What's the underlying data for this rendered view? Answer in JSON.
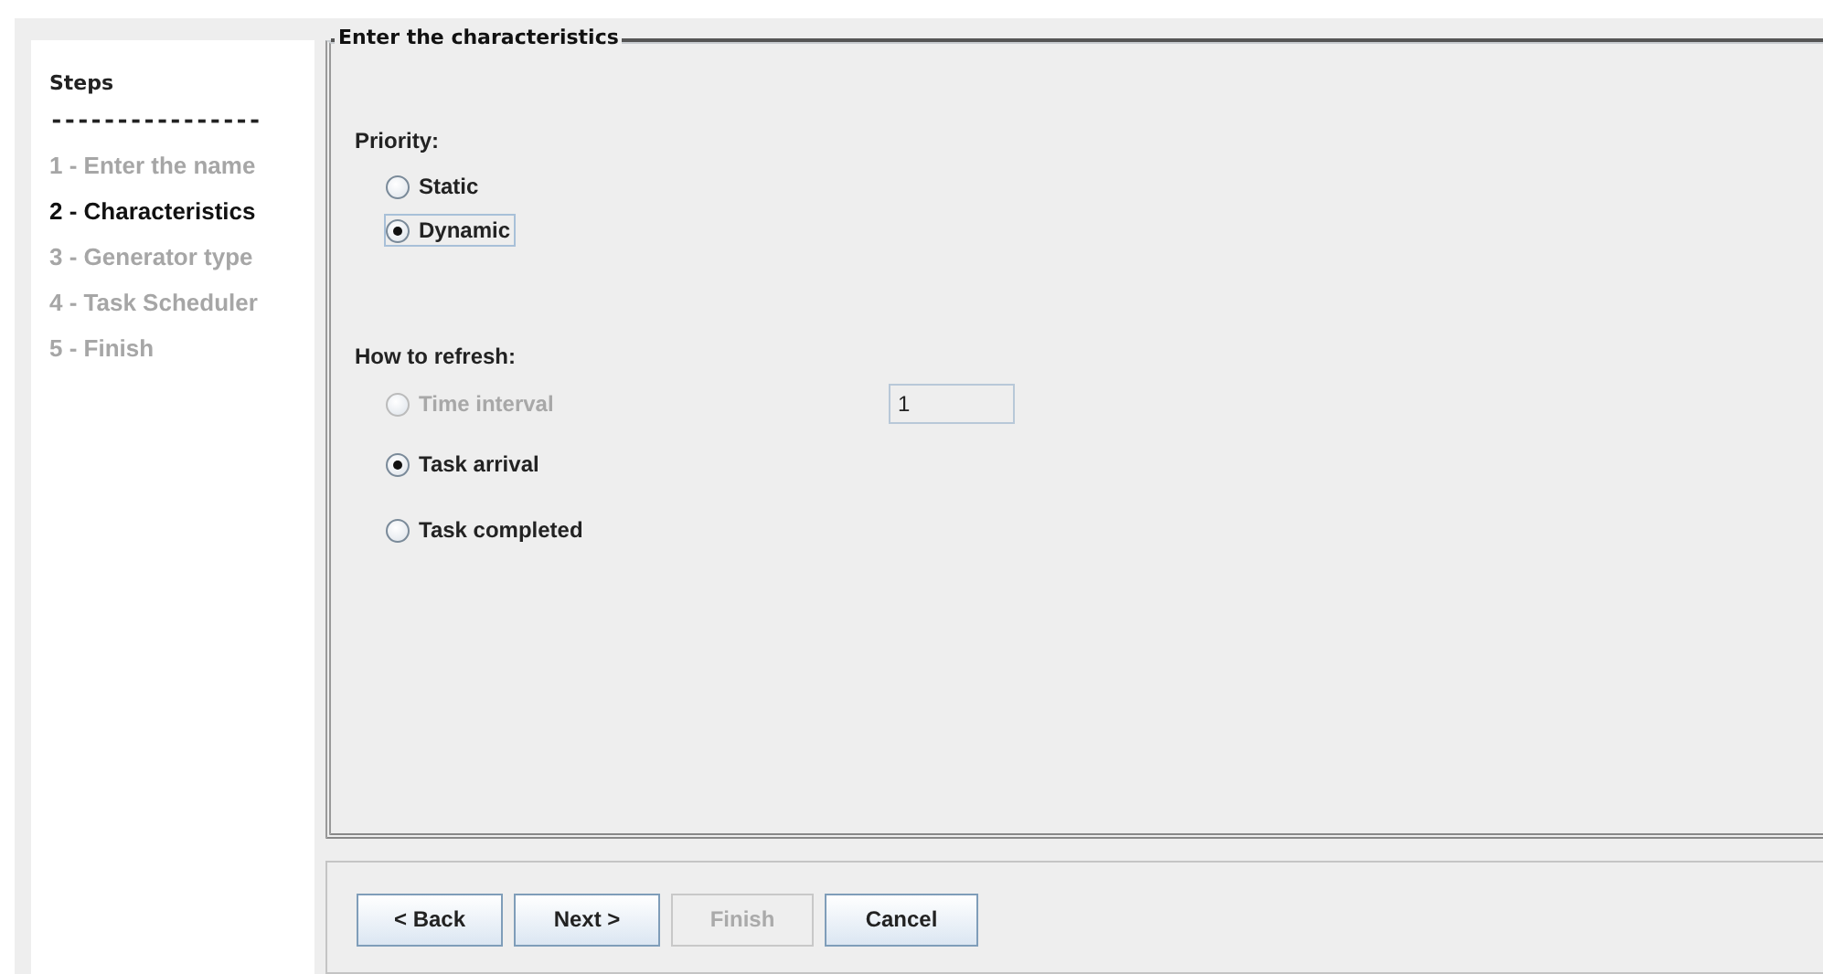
{
  "sidebar": {
    "title": "Steps",
    "separator": "----------------",
    "steps": [
      {
        "label": "1 - Enter the name",
        "selected": false
      },
      {
        "label": "2 - Characteristics",
        "selected": true
      },
      {
        "label": "3 - Generator type",
        "selected": false
      },
      {
        "label": "4 - Task Scheduler",
        "selected": false
      },
      {
        "label": "5 - Finish",
        "selected": false
      }
    ]
  },
  "panel": {
    "title": "Enter the characteristics",
    "groups": [
      {
        "label": "Priority:",
        "options": [
          {
            "label": "Static",
            "selected": false,
            "disabled": false,
            "focused": false
          },
          {
            "label": "Dynamic",
            "selected": true,
            "disabled": false,
            "focused": true
          }
        ]
      },
      {
        "label": "How to refresh:",
        "options": [
          {
            "label": "Time interval",
            "selected": false,
            "disabled": true,
            "focused": false,
            "value": "1"
          },
          {
            "label": "Task arrival",
            "selected": true,
            "disabled": false,
            "focused": false
          },
          {
            "label": "Task completed",
            "selected": false,
            "disabled": false,
            "focused": false
          }
        ]
      }
    ]
  },
  "buttons": [
    {
      "label": "< Back",
      "disabled": false
    },
    {
      "label": "Next >",
      "disabled": false
    },
    {
      "label": "Finish",
      "disabled": true
    },
    {
      "label": "Cancel",
      "disabled": false
    }
  ]
}
